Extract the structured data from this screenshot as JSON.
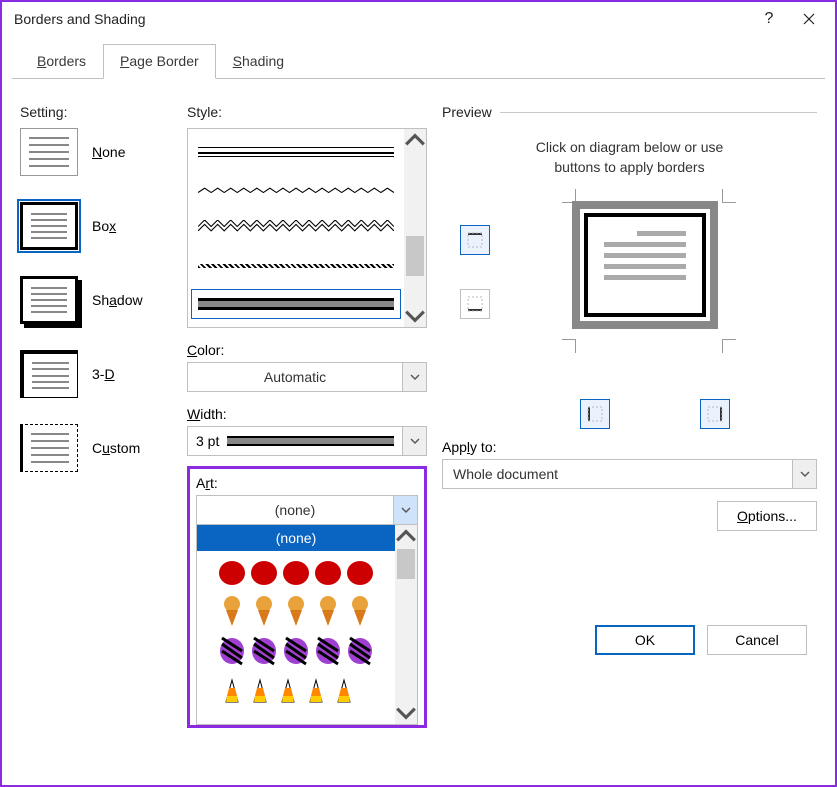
{
  "window": {
    "title": "Borders and Shading"
  },
  "tabs": {
    "borders": "Borders",
    "page_border": "Page Border",
    "shading": "Shading",
    "active": "page_border"
  },
  "setting": {
    "label": "Setting:",
    "none": "None",
    "box": "Box",
    "shadow": "Shadow",
    "three_d": "3-D",
    "custom": "Custom",
    "selected": "box"
  },
  "style": {
    "label": "Style:",
    "selected_index": 4
  },
  "color": {
    "label": "Color:",
    "value": "Automatic"
  },
  "width": {
    "label": "Width:",
    "value": "3 pt"
  },
  "art": {
    "label": "Art:",
    "value": "(none)",
    "dropdown_open": true,
    "options": {
      "none": "(none)",
      "apples": "art-apples",
      "ice_cream": "art-ice-cream-cones",
      "zebra": "art-zebra-stripes",
      "candy_corn": "art-candy-corn"
    }
  },
  "preview": {
    "label": "Preview",
    "hint_line1": "Click on diagram below or use",
    "hint_line2": "buttons to apply borders"
  },
  "apply_to": {
    "label": "Apply to:",
    "value": "Whole document"
  },
  "buttons": {
    "options": "Options...",
    "ok": "OK",
    "cancel": "Cancel"
  }
}
